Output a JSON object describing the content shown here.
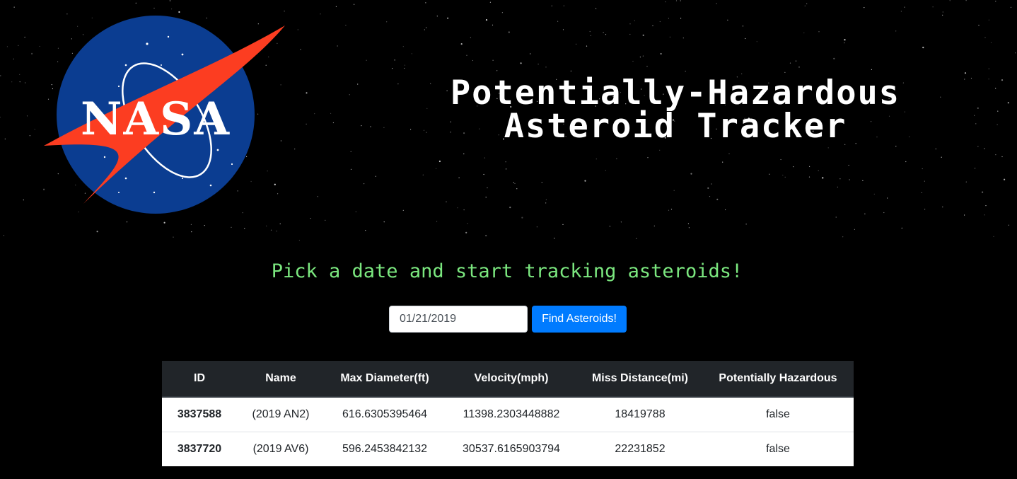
{
  "header": {
    "logo_text": "NASA",
    "title_line1": "Potentially-Hazardous",
    "title_line2": "Asteroid Tracker"
  },
  "tagline": "Pick a date and start tracking asteroids!",
  "search": {
    "date_value": "01/21/2019",
    "button_label": "Find Asteroids!"
  },
  "table": {
    "columns": [
      "ID",
      "Name",
      "Max Diameter(ft)",
      "Velocity(mph)",
      "Miss Distance(mi)",
      "Potentially Hazardous"
    ],
    "rows": [
      [
        "3837588",
        "(2019 AN2)",
        "616.6305395464",
        "11398.2303448882",
        "18419788",
        "false"
      ],
      [
        "3837720",
        "(2019 AV6)",
        "596.2453842132",
        "30537.6165903794",
        "22231852",
        "false"
      ]
    ]
  },
  "colors": {
    "background": "#000000",
    "tagline": "#7be77f",
    "button": "#007bff",
    "table_header": "#212529",
    "logo_blue": "#0b3d91",
    "logo_red": "#fc3d21"
  }
}
